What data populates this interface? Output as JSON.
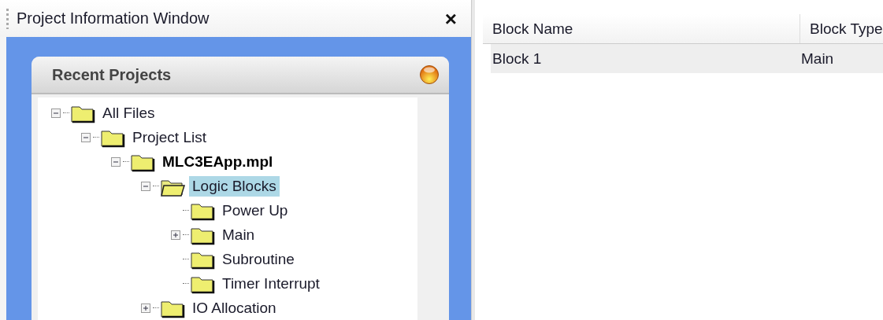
{
  "panel": {
    "title": "Project Information Window",
    "close_glyph": "×"
  },
  "card": {
    "title": "Recent Projects"
  },
  "tree": [
    {
      "label": "All Files",
      "bold": false,
      "selected": false,
      "expanded": true,
      "children": [
        {
          "label": "Project List",
          "bold": false,
          "selected": false,
          "expanded": true,
          "children": [
            {
              "label": "MLC3EApp.mpl",
              "bold": true,
              "selected": false,
              "expanded": true,
              "children": [
                {
                  "label": "Logic Blocks",
                  "bold": false,
                  "selected": true,
                  "expanded": true,
                  "children": [
                    {
                      "label": "Power Up",
                      "bold": false,
                      "selected": false
                    },
                    {
                      "label": "Main",
                      "bold": false,
                      "selected": false,
                      "expanded": false
                    },
                    {
                      "label": "Subroutine",
                      "bold": false,
                      "selected": false
                    },
                    {
                      "label": "Timer Interrupt",
                      "bold": false,
                      "selected": false
                    }
                  ]
                },
                {
                  "label": "IO Allocation",
                  "bold": false,
                  "selected": false,
                  "expanded": false
                }
              ]
            }
          ]
        }
      ]
    }
  ],
  "table": {
    "columns": [
      "Block Name",
      "Block Type"
    ],
    "rows": [
      {
        "cells": [
          "Block 1",
          "Main"
        ],
        "selected": true
      }
    ]
  }
}
